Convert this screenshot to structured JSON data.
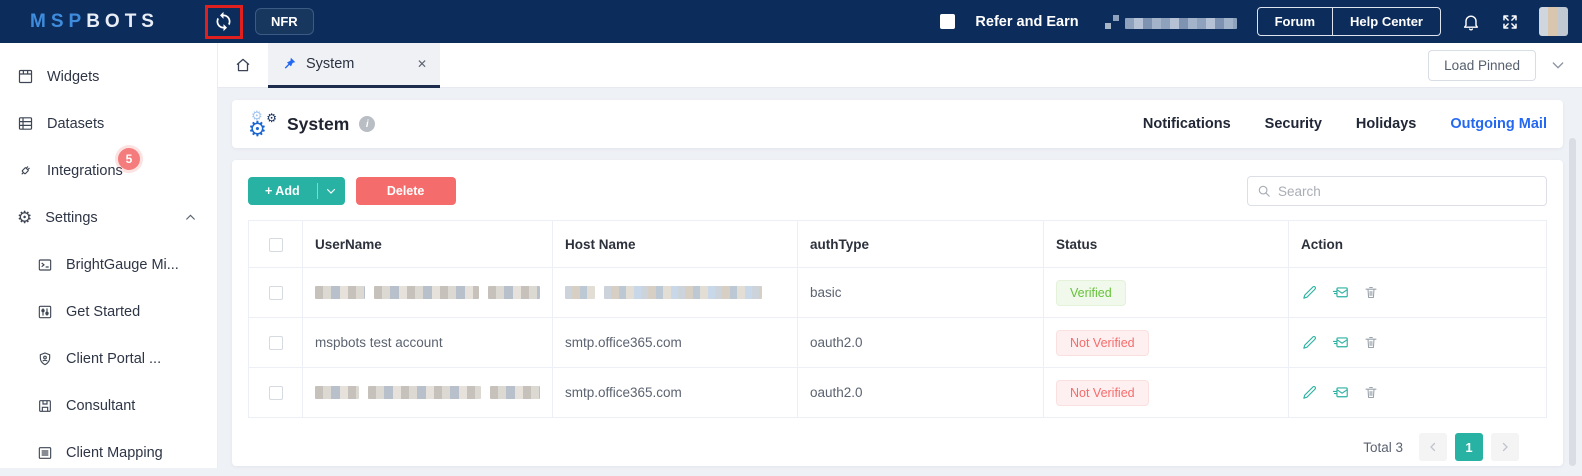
{
  "navbar": {
    "logo_part1": "MSP",
    "logo_part2": "BOTS",
    "nfr_label": "NFR",
    "refer_label": "Refer and Earn",
    "forum_label": "Forum",
    "help_label": "Help Center"
  },
  "sidebar": {
    "items": [
      {
        "label": "Widgets"
      },
      {
        "label": "Datasets"
      },
      {
        "label": "Integrations",
        "badge": "5"
      },
      {
        "label": "Settings"
      }
    ],
    "settings_children": [
      {
        "label": "BrightGauge Mi..."
      },
      {
        "label": "Get Started"
      },
      {
        "label": "Client Portal ..."
      },
      {
        "label": "Consultant"
      },
      {
        "label": "Client Mapping"
      }
    ]
  },
  "tabbar": {
    "active_tab": "System",
    "load_pinned_label": "Load Pinned"
  },
  "header": {
    "title": "System",
    "tabs": [
      {
        "label": "Notifications",
        "active": false
      },
      {
        "label": "Security",
        "active": false
      },
      {
        "label": "Holidays",
        "active": false
      },
      {
        "label": "Outgoing Mail",
        "active": true
      }
    ]
  },
  "toolbar": {
    "add_label": "+ Add",
    "delete_label": "Delete",
    "search_placeholder": "Search"
  },
  "table": {
    "columns": [
      "UserName",
      "Host Name",
      "authType",
      "Status",
      "Action"
    ],
    "rows": [
      {
        "username_redacted": true,
        "host_redacted": true,
        "auth_type": "basic",
        "status": "Verified",
        "status_type": "success"
      },
      {
        "username": "mspbots test account",
        "host": "smtp.office365.com",
        "auth_type": "oauth2.0",
        "status": "Not Verified",
        "status_type": "danger"
      },
      {
        "username_redacted": true,
        "host": "smtp.office365.com",
        "auth_type": "oauth2.0",
        "status": "Not Verified",
        "status_type": "danger"
      }
    ]
  },
  "footer": {
    "total_label": "Total 3",
    "current_page": "1"
  },
  "colors": {
    "navbar_bg": "#0c2c5c",
    "accent_teal": "#27b2a4",
    "danger_red": "#f56c6c",
    "link_blue": "#2468f2",
    "verified_green": "#67c23a",
    "highlight_annotation_red": "#e01f1f",
    "active_tab_underline": "#1d2c4c"
  }
}
